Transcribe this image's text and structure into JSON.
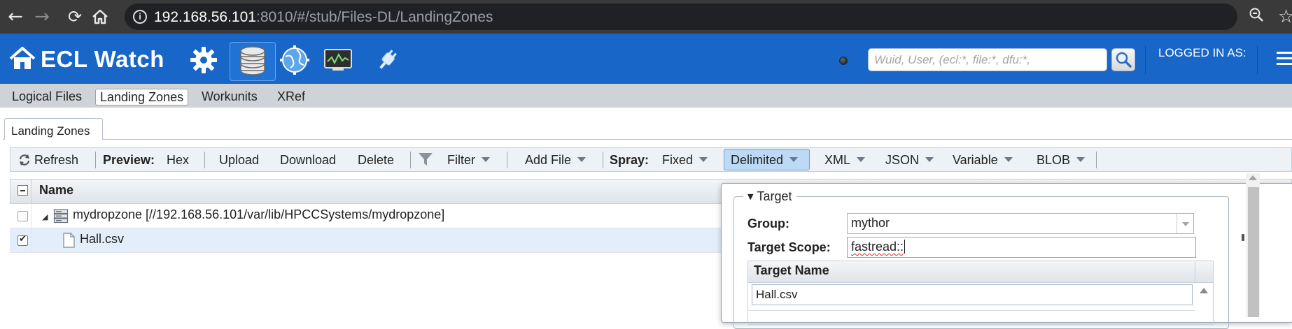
{
  "browser": {
    "url_host": "192.168.56.101",
    "url_rest": ":8010/#/stub/Files-DL/LandingZones"
  },
  "header": {
    "brand": "ECL Watch",
    "search_placeholder": "Wuid, User, (ecl:*, file:*, dfu:*,",
    "logged_in_label": "LOGGED IN AS:",
    "colors": {
      "header_bg": "#1766c8",
      "subnav_bg": "#cfd3d7"
    }
  },
  "subnav": {
    "items": [
      "Logical Files",
      "Landing Zones",
      "Workunits",
      "XRef"
    ],
    "active": "Landing Zones"
  },
  "page_tab": "Landing Zones",
  "toolbar": {
    "refresh": "Refresh",
    "preview_label": "Preview:",
    "hex": "Hex",
    "upload": "Upload",
    "download": "Download",
    "delete": "Delete",
    "filter": "Filter",
    "add_file": "Add File",
    "spray_label": "Spray:",
    "fixed": "Fixed",
    "delimited": "Delimited",
    "xml": "XML",
    "json": "JSON",
    "variable": "Variable",
    "blob": "BLOB"
  },
  "grid": {
    "column_name": "Name",
    "rows": [
      {
        "label": "mydropzone [//192.168.56.101/var/lib/HPCCSystems/mydropzone]",
        "checked": false,
        "type": "dropzone"
      },
      {
        "label": "Hall.csv",
        "checked": true,
        "type": "file"
      }
    ]
  },
  "dialog": {
    "legend": "Target",
    "group_label": "Group:",
    "group_value": "mythor",
    "scope_label": "Target  Scope:",
    "scope_value": "fastread::",
    "target_name_header": "Target Name",
    "target_name_value": "Hall.csv"
  }
}
